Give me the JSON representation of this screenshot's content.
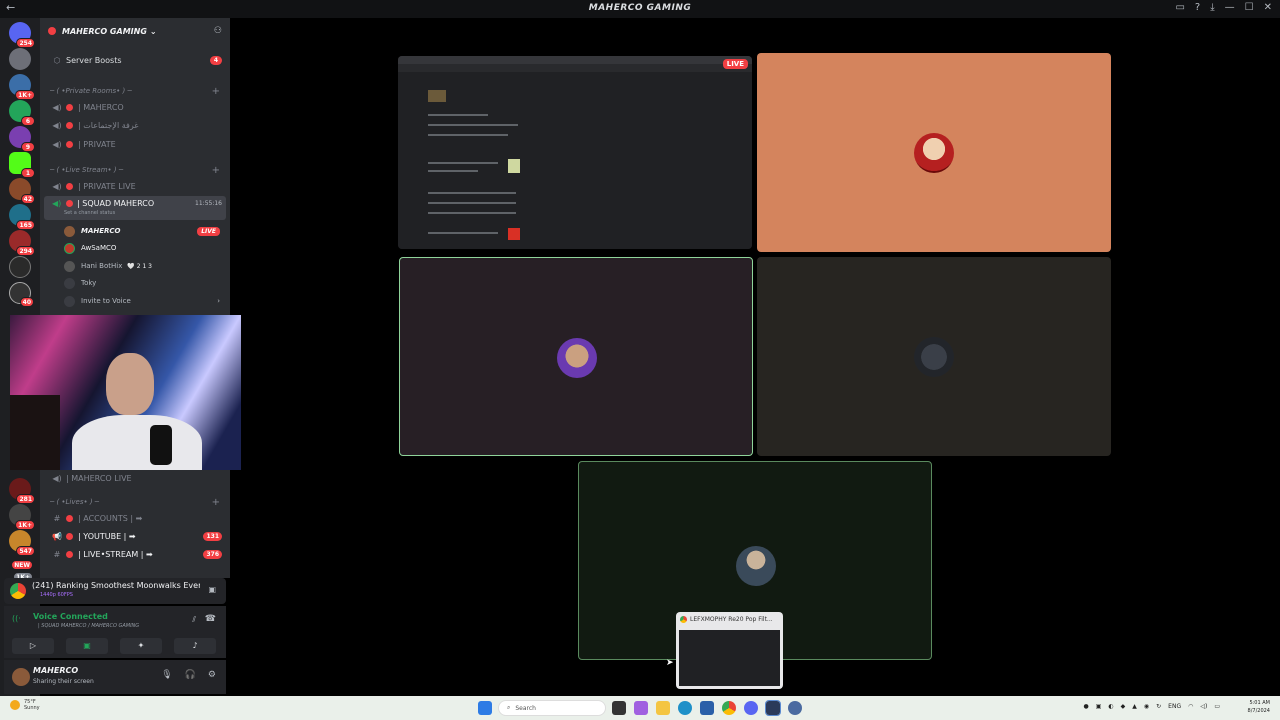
{
  "window": {
    "title": "MAHERCO GAMING",
    "back_icon": "arrow-left-icon"
  },
  "guild_badges": [
    "254",
    "1K+",
    "6",
    "9",
    "1",
    "42",
    "165",
    "294",
    "40",
    "281",
    "1K+",
    "547",
    "NEW",
    "1K+"
  ],
  "server": {
    "name": "MAHERCO GAMING"
  },
  "channels": {
    "server_boosts": {
      "label": "Server Boosts",
      "count": "4"
    },
    "cat_private": "─ ( •Private Rooms• ) ─",
    "private": [
      "| MAHERCO",
      "| غرفة الإجتماعات",
      "| PRIVATE"
    ],
    "cat_live": "─ ( •Live Stream• ) ─",
    "private_live": "| PRIVATE LIVE",
    "squad": {
      "label": "| SQUAD MAHERCO",
      "time": "11:55:16",
      "status": "Set a channel status"
    },
    "voice_users": [
      {
        "name": "MAHERCO",
        "badge": "LIVE"
      },
      {
        "name": "AwSaMCO",
        "badge": ""
      },
      {
        "name": "Hani BotHix",
        "badge": "🤍 2 1 3"
      },
      {
        "name": "Toky",
        "badge": ""
      }
    ],
    "invite": "Invite to Voice",
    "hidden_live": "| MAHERCO LIVE",
    "cat_lives": "─ ( •Lives• ) ─",
    "lives": [
      {
        "label": "| ACCOUNTS | ➡",
        "count": ""
      },
      {
        "label": "| YOUTUBE | ➡",
        "count": "131"
      },
      {
        "label": "| LIVE•STREAM | ➡",
        "count": "376"
      }
    ]
  },
  "activity": {
    "title": "(241) Ranking Smoothest Moonwalks Ever...",
    "sub": "1440p 60FPS"
  },
  "voice": {
    "title": "Voice Connected",
    "sub": "| SQUAD MAHERCO / MAHERCO GAMING"
  },
  "user": {
    "name": "MAHERCO",
    "status": "Sharing their screen"
  },
  "stage": {
    "live_tag": "LIVE"
  },
  "preview": {
    "title": "LEFXMOPHY Re20 Pop Filt..."
  },
  "taskbar": {
    "temp": "75°F",
    "weather": "Sunny",
    "search": "Search",
    "lang": "ENG",
    "time": "5:01 AM",
    "date": "8/7/2024"
  }
}
